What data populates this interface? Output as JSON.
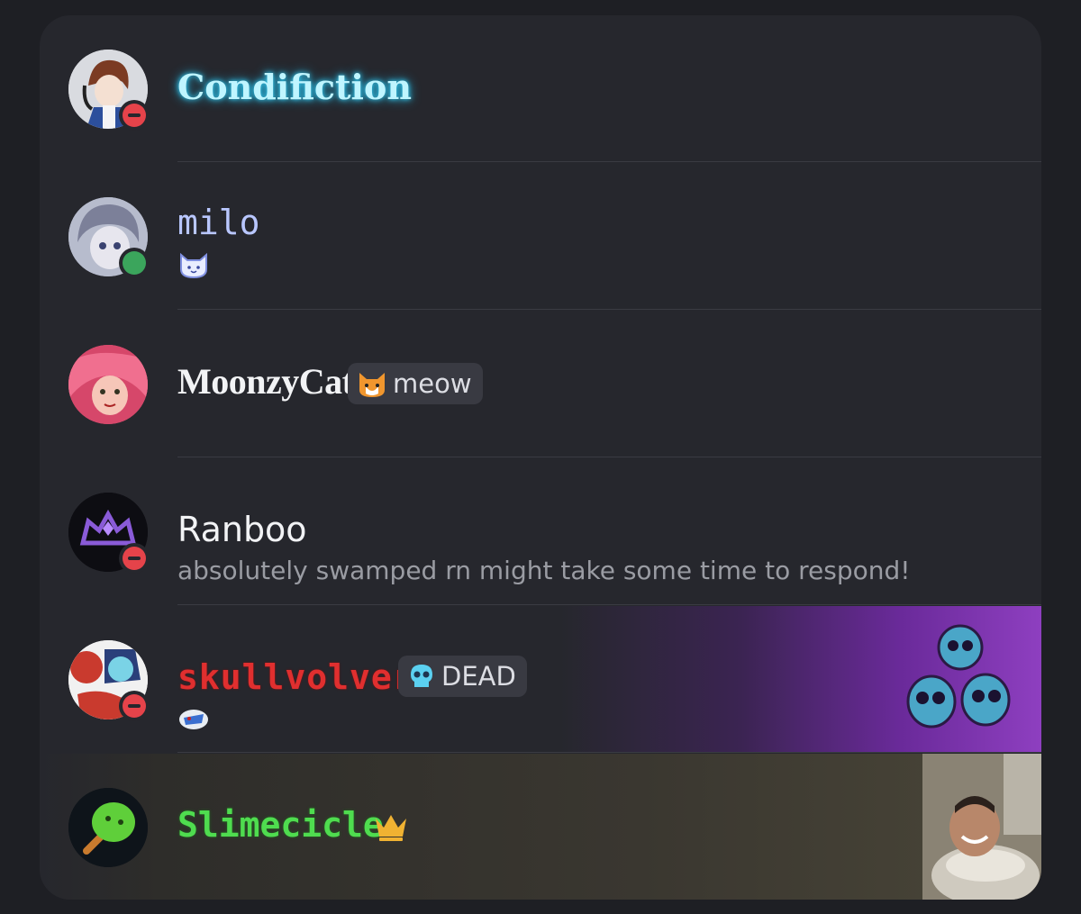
{
  "members": [
    {
      "name": "Condifiction",
      "status": "dnd",
      "status_color": "#e5434a",
      "name_color": "#bff5ff"
    },
    {
      "name": "milo",
      "status": "online",
      "status_color": "#3ba55c",
      "name_color": "#b9c7ff",
      "custom_status_icon": "cat-face-icon"
    },
    {
      "name": "MoonzyCat",
      "tag": {
        "icon": "cat-face-icon",
        "label": "meow"
      },
      "name_color": "#f2f3f5"
    },
    {
      "name": "Ranboo",
      "status": "dnd",
      "status_color": "#e5434a",
      "custom_status": "absolutely swamped rn might take some time to respond!",
      "name_color": "#f2f3f5"
    },
    {
      "name": "skullvolver",
      "status": "dnd",
      "status_color": "#e5434a",
      "tag": {
        "icon": "skull-icon",
        "label": "DEAD"
      },
      "name_color": "#e02f2f",
      "custom_status_icon": "sticker-icon"
    },
    {
      "name": "Slimecicle",
      "owner_icon": "crown-icon",
      "name_color": "#4fdc4f"
    }
  ]
}
